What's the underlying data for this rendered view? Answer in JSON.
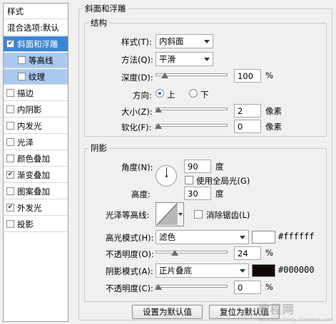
{
  "style_list": {
    "header": "样式",
    "blend_default": "混合选项:默认",
    "items": [
      {
        "label": "斜面和浮雕",
        "checked": true
      },
      {
        "label": "等高线",
        "checked": false
      },
      {
        "label": "纹理",
        "checked": false
      },
      {
        "label": "描边",
        "checked": false
      },
      {
        "label": "内阴影",
        "checked": false
      },
      {
        "label": "内发光",
        "checked": false
      },
      {
        "label": "光泽",
        "checked": false
      },
      {
        "label": "颜色叠加",
        "checked": false
      },
      {
        "label": "渐变叠加",
        "checked": true
      },
      {
        "label": "图案叠加",
        "checked": false
      },
      {
        "label": "外发光",
        "checked": true
      },
      {
        "label": "投影",
        "checked": false
      }
    ]
  },
  "bevel": {
    "title": "斜面和浮雕",
    "structure": {
      "title": "结构",
      "style_label": "样式(T):",
      "style_value": "内斜面",
      "technique_label": "方法(Q):",
      "technique_value": "平滑",
      "depth_label": "深度(D):",
      "depth_value": "100",
      "depth_unit": "%",
      "direction_label": "方向:",
      "dir_up": "上",
      "dir_down": "下",
      "size_label": "大小(Z):",
      "size_value": "2",
      "size_unit": "像素",
      "soften_label": "软化(F):",
      "soften_value": "0",
      "soften_unit": "像素"
    },
    "shading": {
      "title": "阴影",
      "angle_label": "角度(N):",
      "angle_value": "90",
      "angle_unit": "度",
      "global_light_label": "使用全局光(G)",
      "altitude_label": "高度:",
      "altitude_value": "30",
      "altitude_unit": "度",
      "gloss_label": "光泽等高线:",
      "antialias_label": "消除锯齿(L)",
      "highlight_label": "高光模式(H):",
      "highlight_mode": "滤色",
      "highlight_color": "#ffffff",
      "highlight_hex": "#ffffff",
      "hl_opacity_label": "不透明度(O):",
      "hl_opacity_value": "24",
      "hl_opacity_unit": "%",
      "shadow_label": "阴影模式(A):",
      "shadow_mode": "正片叠底",
      "shadow_color": "#000000",
      "shadow_hex": "#000000",
      "sh_opacity_label": "不透明度(C):",
      "sh_opacity_value": "0",
      "sh_opacity_unit": "%"
    }
  },
  "buttons": {
    "make_default": "设置为默认值",
    "reset_default": "复位为默认值"
  },
  "watermark": {
    "text": "教程网",
    "sub": "www.jiaocheng.chazidian.com"
  }
}
